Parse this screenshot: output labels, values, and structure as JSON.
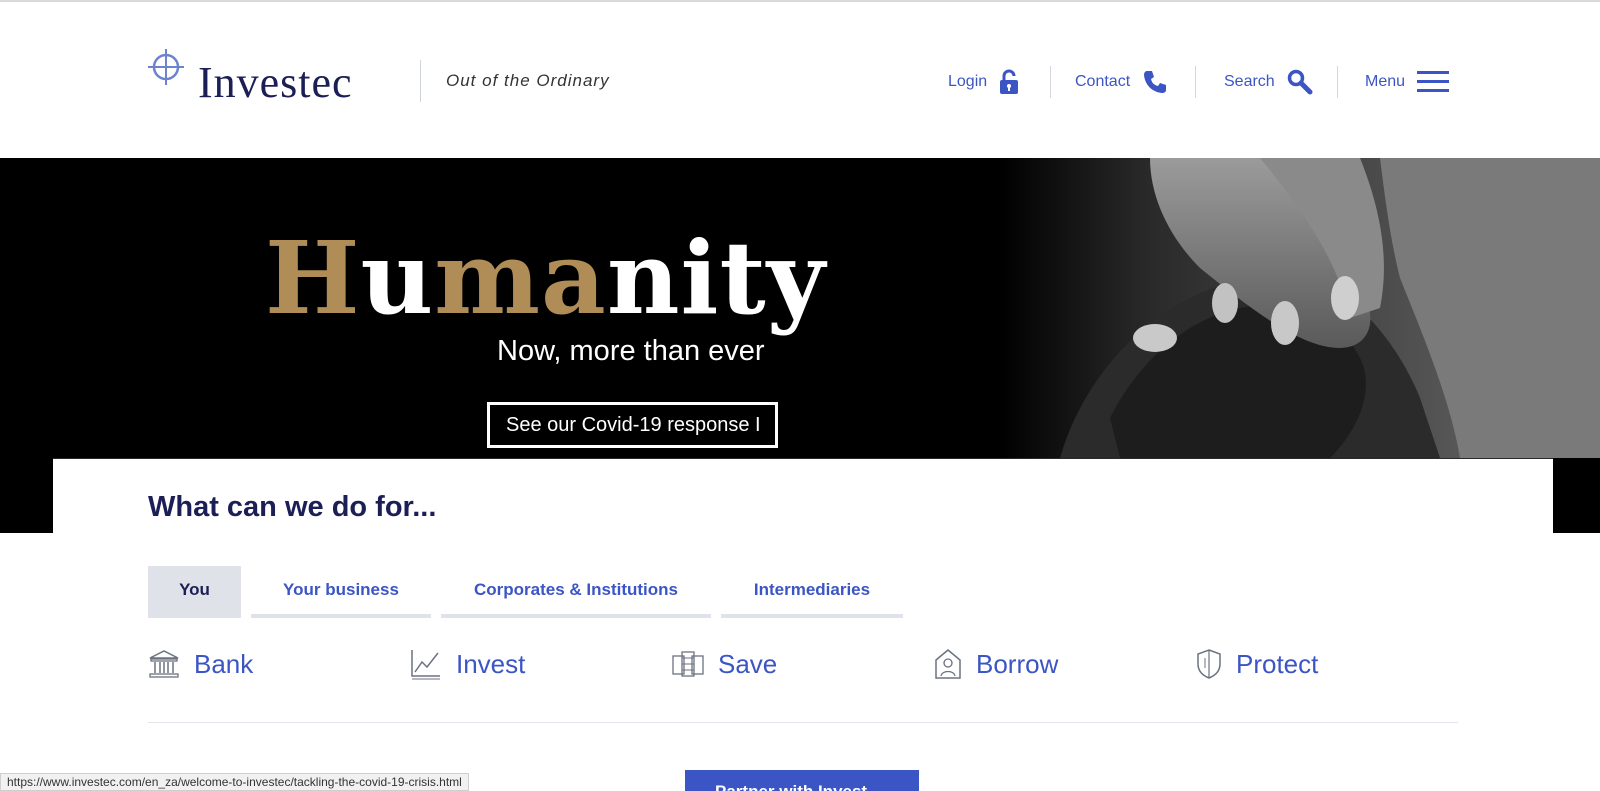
{
  "header": {
    "brand": "Investec",
    "tagline": "Out of the Ordinary",
    "nav": [
      {
        "label": "Login",
        "icon": "lock-icon"
      },
      {
        "label": "Contact",
        "icon": "phone-icon"
      },
      {
        "label": "Search",
        "icon": "search-icon"
      },
      {
        "label": "Menu",
        "icon": "hamburger-icon"
      }
    ]
  },
  "hero": {
    "title_parts": [
      "H",
      "u",
      "ma",
      "nity"
    ],
    "subtitle": "Now, more than ever",
    "button_label": "See our Covid-19 response I"
  },
  "section": {
    "title": "What can we do for...",
    "tabs": [
      "You",
      "Your business",
      "Corporates & Institutions",
      "Intermediaries"
    ],
    "active_tab": "You",
    "products": [
      {
        "label": "Bank",
        "icon": "bank-icon"
      },
      {
        "label": "Invest",
        "icon": "chart-icon"
      },
      {
        "label": "Save",
        "icon": "coins-icon"
      },
      {
        "label": "Borrow",
        "icon": "house-person-icon"
      },
      {
        "label": "Protect",
        "icon": "shield-icon"
      }
    ],
    "cta_label": "Partner with Invest..."
  },
  "status_url": "https://www.investec.com/en_za/welcome-to-investec/tackling-the-covid-19-crisis.html",
  "colors": {
    "accent": "#3c55c4",
    "navy": "#1c1f55",
    "gold": "#b08d57",
    "tab_bg": "#dfe2e8"
  }
}
